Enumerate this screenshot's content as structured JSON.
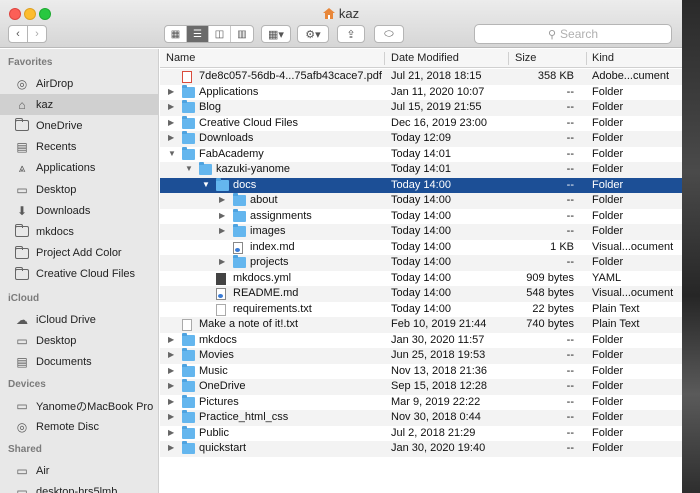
{
  "window": {
    "title": "kaz"
  },
  "toolbar": {
    "back_label": "‹",
    "forward_label": "›",
    "views": [
      "▦",
      "☰",
      "◫",
      "▥"
    ],
    "arrange_label": "▦▾",
    "action_label": "⚙▾",
    "share_label": "⇪",
    "tag_label": "⬭",
    "search_placeholder": "Search"
  },
  "sidebar": {
    "favorites_label": "Favorites",
    "favorites": [
      {
        "label": "AirDrop",
        "icon": "airdrop-icon",
        "glyph": "◎"
      },
      {
        "label": "kaz",
        "icon": "home-icon",
        "glyph": "⌂",
        "selected": true
      },
      {
        "label": "OneDrive",
        "icon": "folder-icon",
        "glyph": ""
      },
      {
        "label": "Recents",
        "icon": "recents-icon",
        "glyph": "▤"
      },
      {
        "label": "Applications",
        "icon": "applications-icon",
        "glyph": "⩓"
      },
      {
        "label": "Desktop",
        "icon": "desktop-icon",
        "glyph": "▭"
      },
      {
        "label": "Downloads",
        "icon": "downloads-icon",
        "glyph": "⬇"
      },
      {
        "label": "mkdocs",
        "icon": "folder-icon",
        "glyph": ""
      },
      {
        "label": "Project Add Color",
        "icon": "folder-icon",
        "glyph": ""
      },
      {
        "label": "Creative Cloud Files",
        "icon": "folder-icon",
        "glyph": ""
      }
    ],
    "icloud_label": "iCloud",
    "icloud": [
      {
        "label": "iCloud Drive",
        "icon": "cloud-icon",
        "glyph": "☁"
      },
      {
        "label": "Desktop",
        "icon": "desktop-icon",
        "glyph": "▭"
      },
      {
        "label": "Documents",
        "icon": "documents-icon",
        "glyph": "▤"
      }
    ],
    "devices_label": "Devices",
    "devices": [
      {
        "label": "YanomeのMacBook Pro",
        "icon": "laptop-icon",
        "glyph": "▭"
      },
      {
        "label": "Remote Disc",
        "icon": "disc-icon",
        "glyph": "◎"
      }
    ],
    "shared_label": "Shared",
    "shared": [
      {
        "label": "Air",
        "icon": "computer-icon",
        "glyph": "▭"
      },
      {
        "label": "desktop-hrs5lmb",
        "icon": "computer-icon",
        "glyph": "▭"
      }
    ]
  },
  "columns": {
    "name": "Name",
    "modified": "Date Modified",
    "size": "Size",
    "kind": "Kind"
  },
  "files": [
    {
      "name": "7de8c057-56db-4...75afb43cace7.pdf",
      "modified": "Jul 21, 2018 18:15",
      "size": "358 KB",
      "kind": "Adobe...cument",
      "depth": 0,
      "type": "pdf",
      "tri": ""
    },
    {
      "name": "Applications",
      "modified": "Jan 11, 2020 10:07",
      "size": "--",
      "kind": "Folder",
      "depth": 0,
      "type": "folder",
      "tri": "▶"
    },
    {
      "name": "Blog",
      "modified": "Jul 15, 2019 21:55",
      "size": "--",
      "kind": "Folder",
      "depth": 0,
      "type": "folder",
      "tri": "▶"
    },
    {
      "name": "Creative Cloud Files",
      "modified": "Dec 16, 2019 23:00",
      "size": "--",
      "kind": "Folder",
      "depth": 0,
      "type": "folder",
      "tri": "▶"
    },
    {
      "name": "Downloads",
      "modified": "Today 12:09",
      "size": "--",
      "kind": "Folder",
      "depth": 0,
      "type": "folder",
      "tri": "▶"
    },
    {
      "name": "FabAcademy",
      "modified": "Today 14:01",
      "size": "--",
      "kind": "Folder",
      "depth": 0,
      "type": "folder",
      "tri": "▼"
    },
    {
      "name": "kazuki-yanome",
      "modified": "Today 14:01",
      "size": "--",
      "kind": "Folder",
      "depth": 1,
      "type": "folder",
      "tri": "▼"
    },
    {
      "name": "docs",
      "modified": "Today 14:00",
      "size": "--",
      "kind": "Folder",
      "depth": 2,
      "type": "folder",
      "tri": "▼",
      "selected": true
    },
    {
      "name": "about",
      "modified": "Today 14:00",
      "size": "--",
      "kind": "Folder",
      "depth": 3,
      "type": "folder",
      "tri": "▶"
    },
    {
      "name": "assignments",
      "modified": "Today 14:00",
      "size": "--",
      "kind": "Folder",
      "depth": 3,
      "type": "folder",
      "tri": "▶"
    },
    {
      "name": "images",
      "modified": "Today 14:00",
      "size": "--",
      "kind": "Folder",
      "depth": 3,
      "type": "folder",
      "tri": "▶"
    },
    {
      "name": "index.md",
      "modified": "Today 14:00",
      "size": "1 KB",
      "kind": "Visual...ocument",
      "depth": 3,
      "type": "md",
      "tri": ""
    },
    {
      "name": "projects",
      "modified": "Today 14:00",
      "size": "--",
      "kind": "Folder",
      "depth": 3,
      "type": "folder",
      "tri": "▶"
    },
    {
      "name": "mkdocs.yml",
      "modified": "Today 14:00",
      "size": "909 bytes",
      "kind": "YAML",
      "depth": 2,
      "type": "yml",
      "tri": ""
    },
    {
      "name": "README.md",
      "modified": "Today 14:00",
      "size": "548 bytes",
      "kind": "Visual...ocument",
      "depth": 2,
      "type": "md",
      "tri": ""
    },
    {
      "name": "requirements.txt",
      "modified": "Today 14:00",
      "size": "22 bytes",
      "kind": "Plain Text",
      "depth": 2,
      "type": "doc",
      "tri": ""
    },
    {
      "name": "Make a note of it!.txt",
      "modified": "Feb 10, 2019 21:44",
      "size": "740 bytes",
      "kind": "Plain Text",
      "depth": 0,
      "type": "doc",
      "tri": ""
    },
    {
      "name": "mkdocs",
      "modified": "Jan 30, 2020 11:57",
      "size": "--",
      "kind": "Folder",
      "depth": 0,
      "type": "folder",
      "tri": "▶"
    },
    {
      "name": "Movies",
      "modified": "Jun 25, 2018 19:53",
      "size": "--",
      "kind": "Folder",
      "depth": 0,
      "type": "folder",
      "tri": "▶"
    },
    {
      "name": "Music",
      "modified": "Nov 13, 2018 21:36",
      "size": "--",
      "kind": "Folder",
      "depth": 0,
      "type": "folder",
      "tri": "▶"
    },
    {
      "name": "OneDrive",
      "modified": "Sep 15, 2018 12:28",
      "size": "--",
      "kind": "Folder",
      "depth": 0,
      "type": "folder",
      "tri": "▶"
    },
    {
      "name": "Pictures",
      "modified": "Mar 9, 2019 22:22",
      "size": "--",
      "kind": "Folder",
      "depth": 0,
      "type": "folder",
      "tri": "▶"
    },
    {
      "name": "Practice_html_css",
      "modified": "Nov 30, 2018 0:44",
      "size": "--",
      "kind": "Folder",
      "depth": 0,
      "type": "folder",
      "tri": "▶"
    },
    {
      "name": "Public",
      "modified": "Jul 2, 2018 21:29",
      "size": "--",
      "kind": "Folder",
      "depth": 0,
      "type": "folder",
      "tri": "▶"
    },
    {
      "name": "quickstart",
      "modified": "Jan 30, 2020 19:40",
      "size": "--",
      "kind": "Folder",
      "depth": 0,
      "type": "folder",
      "tri": "▶"
    }
  ],
  "colors": {
    "selection": "#1c4f96",
    "folder": "#64b6ee",
    "sidebar": "#e8e8e8"
  }
}
